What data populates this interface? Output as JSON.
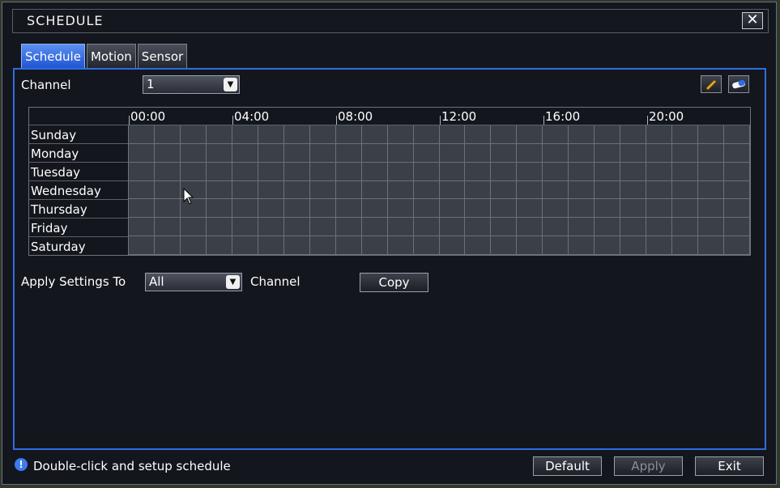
{
  "window": {
    "title": "SCHEDULE",
    "close_symbol": "✕"
  },
  "tabs": [
    {
      "label": "Schedule",
      "active": true
    },
    {
      "label": "Motion",
      "active": false
    },
    {
      "label": "Sensor",
      "active": false
    }
  ],
  "channel": {
    "label": "Channel",
    "value": "1"
  },
  "toolbar": {
    "edit_icon": "pencil-icon",
    "erase_icon": "eraser-icon"
  },
  "schedule_grid": {
    "time_labels": [
      "00:00",
      "04:00",
      "08:00",
      "12:00",
      "16:00",
      "20:00"
    ],
    "days": [
      "Sunday",
      "Monday",
      "Tuesday",
      "Wednesday",
      "Thursday",
      "Friday",
      "Saturday"
    ],
    "hours_per_day": 24
  },
  "apply_settings": {
    "label": "Apply Settings To",
    "value": "All",
    "suffix": "Channel",
    "copy_label": "Copy"
  },
  "footer": {
    "hint": "Double-click and setup schedule",
    "default_label": "Default",
    "apply_label": "Apply",
    "exit_label": "Exit"
  },
  "colors": {
    "accent": "#2f6de0",
    "cell": "#3b4048",
    "background": "#14161e"
  }
}
